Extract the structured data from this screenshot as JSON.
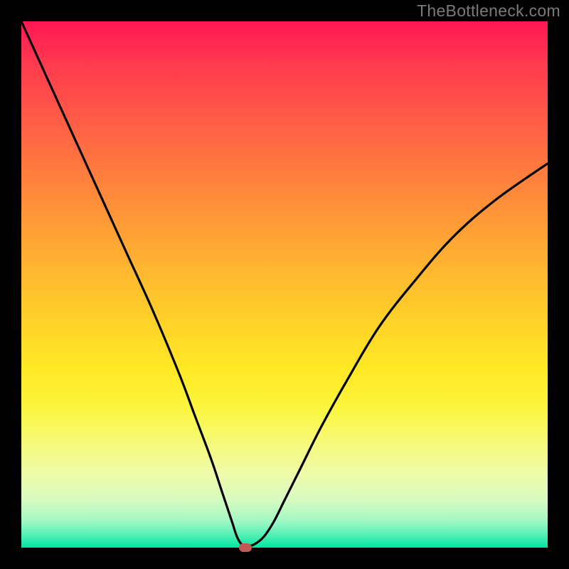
{
  "watermark": "TheBottleneck.com",
  "chart_data": {
    "type": "line",
    "title": "",
    "xlabel": "",
    "ylabel": "",
    "xlim": [
      0,
      100
    ],
    "ylim": [
      0,
      100
    ],
    "grid": false,
    "colors": {
      "gradient_top": "#ff1754",
      "gradient_bottom": "#00e59e",
      "curve": "#000000",
      "marker": "#c15a56",
      "frame": "#000000"
    },
    "series": [
      {
        "name": "bottleneck-curve",
        "x": [
          0,
          5,
          10,
          15,
          20,
          25,
          30,
          33,
          36,
          38,
          40,
          41,
          42,
          43,
          44,
          46,
          48,
          50,
          53,
          57,
          62,
          68,
          75,
          82,
          90,
          100
        ],
        "values": [
          100,
          89,
          78,
          67,
          56,
          45,
          33,
          25,
          17,
          11,
          5,
          2,
          0.5,
          0.5,
          0.5,
          2,
          5,
          9,
          15,
          23,
          32,
          42,
          51,
          59,
          66,
          73
        ]
      }
    ],
    "marker": {
      "x": 42.5,
      "y": 0
    }
  }
}
